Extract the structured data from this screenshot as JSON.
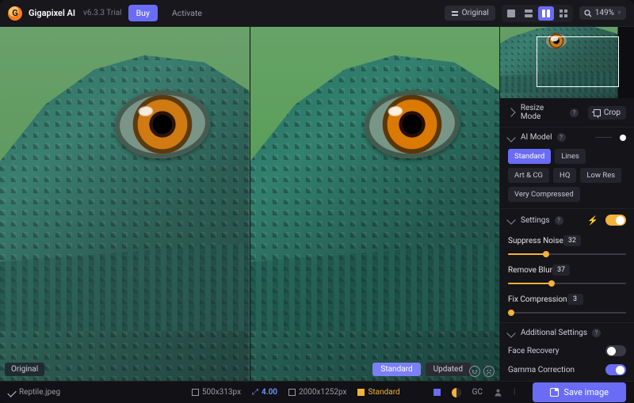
{
  "app": {
    "name": "Gigapixel AI",
    "version": "v6.3.3 Trial"
  },
  "topbar": {
    "buy": "Buy",
    "activate": "Activate",
    "original_chip": "Original",
    "zoom": "149%",
    "view_modes": [
      "single",
      "split-h",
      "split-v",
      "side-by-side"
    ],
    "view_active": 2
  },
  "viewer": {
    "left_label": "Original",
    "right_primary": "Standard",
    "right_secondary": "Updated"
  },
  "panel": {
    "resize_mode": {
      "label": "Resize Mode",
      "crop": "Crop"
    },
    "ai_model": {
      "label": "AI Model",
      "options": [
        "Standard",
        "Lines",
        "Art & CG",
        "HQ",
        "Low Res",
        "Very Compressed"
      ],
      "active": "Standard"
    },
    "settings": {
      "label": "Settings",
      "auto": true,
      "suppress_noise": {
        "label": "Suppress Noise",
        "value": 32
      },
      "remove_blur": {
        "label": "Remove Blur",
        "value": 37
      },
      "fix_compression": {
        "label": "Fix Compression",
        "value": 3
      }
    },
    "additional": {
      "label": "Additional Settings",
      "face_recovery": {
        "label": "Face Recovery",
        "on": false
      },
      "gamma": {
        "label": "Gamma Correction",
        "on": true
      }
    }
  },
  "status": {
    "filename": "Reptile.jpeg",
    "in_dims": "500x313px",
    "scale": "4.00",
    "out_dims": "2000x1252px",
    "model": "Standard",
    "gc": "GC",
    "save": "Save image"
  },
  "icons": {
    "stack": "stack-icon",
    "search": "search-icon",
    "gear": "gear-icon",
    "crop": "crop-icon",
    "bolt": "bolt-icon",
    "half": "contrast-icon",
    "person": "person-icon",
    "disk": "save-icon"
  }
}
